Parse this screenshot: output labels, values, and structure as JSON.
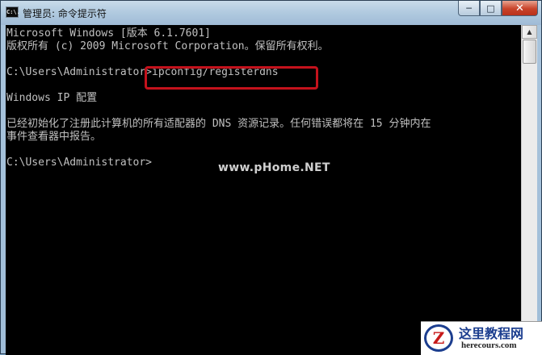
{
  "window": {
    "title": "管理员: 命令提示符",
    "app_icon_text": "C:\\.",
    "controls": {
      "minimize": "─",
      "maximize": "□",
      "close": "✕"
    }
  },
  "console": {
    "lines": [
      "Microsoft Windows [版本 6.1.7601]",
      "版权所有 (c) 2009 Microsoft Corporation。保留所有权利。",
      "",
      "C:\\Users\\Administrator>ipconfig/registerdns",
      "",
      "Windows IP 配置",
      "",
      "已经初始化了注册此计算机的所有适配器的 DNS 资源记录。任何错误都将在 15 分钟内在",
      "事件查看器中报告。",
      "",
      "C:\\Users\\Administrator>"
    ]
  },
  "watermark": "www.pHome.NET",
  "logo": {
    "mark": "Z",
    "cn": "这里教程网",
    "en": "herecours.com"
  },
  "colors": {
    "console_bg": "#000000",
    "console_text": "#c0c0c0",
    "highlight": "#c4121c"
  }
}
